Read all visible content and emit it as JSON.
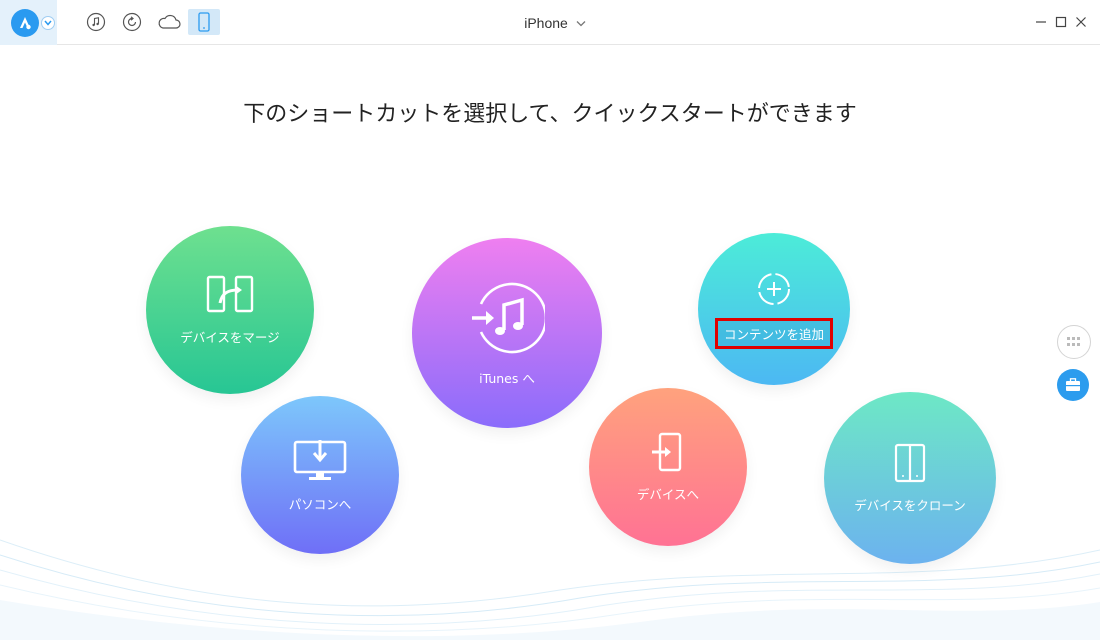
{
  "titlebar": {
    "device_name": "iPhone",
    "nav_icons": [
      "music-icon",
      "restore-icon",
      "cloud-icon",
      "phone-icon"
    ],
    "active_nav": "phone-icon"
  },
  "heading": "下のショートカットを選択して、クイックスタートができます",
  "shortcuts": {
    "merge": "デバイスをマージ",
    "pc": "パソコンへ",
    "itunes": "iTunes へ",
    "add": "コンテンツを追加",
    "device": "デバイスへ",
    "clone": "デバイスをクローン"
  },
  "colors": {
    "accent": "#2a9af0",
    "highlight_border": "#e00000"
  }
}
